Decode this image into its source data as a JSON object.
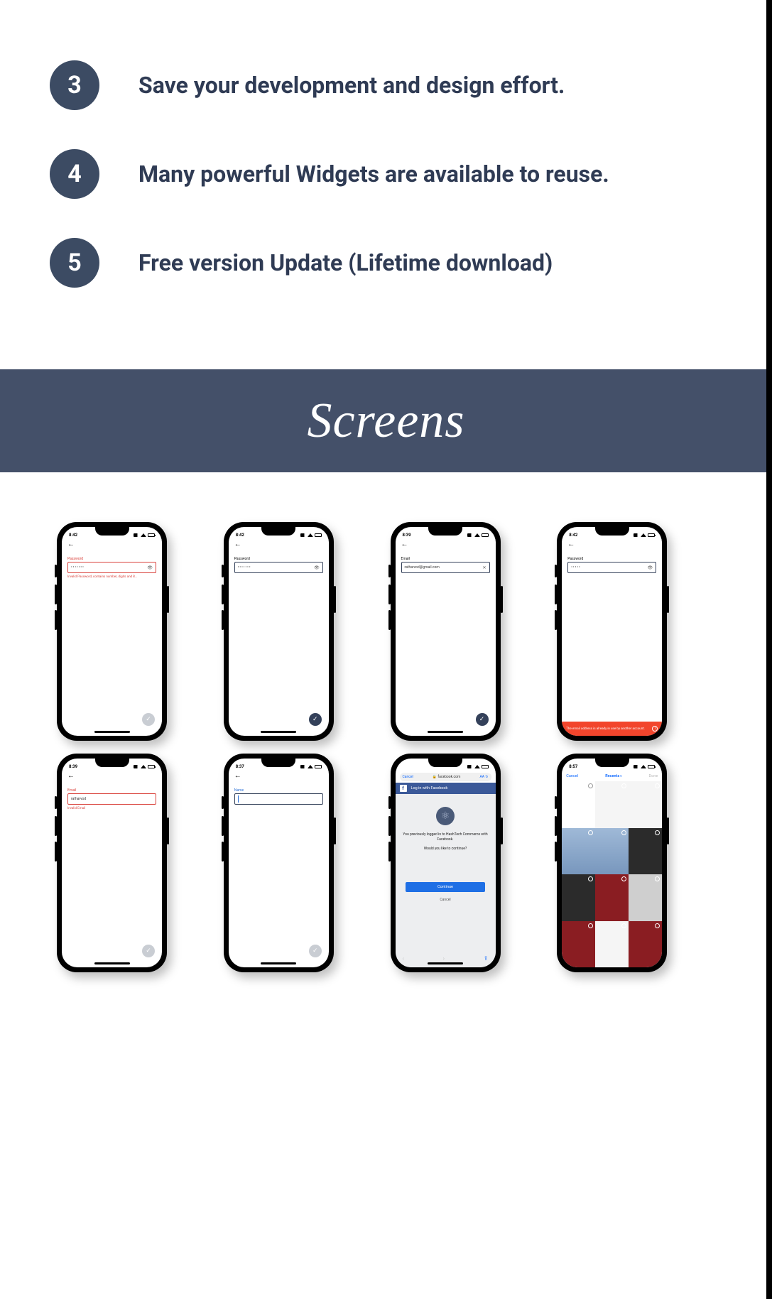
{
  "features": [
    {
      "num": "3",
      "text": "Save your development and design effort."
    },
    {
      "num": "4",
      "text": "Many powerful Widgets are available to reuse."
    },
    {
      "num": "5",
      "text": "Free version Update (Lifetime download)"
    }
  ],
  "section_title": "Screens",
  "phones": {
    "p1": {
      "time": "8:42",
      "label": "Password",
      "value": "•••••••",
      "helper": "Invalid Password, contains number, digits and 8…"
    },
    "p2": {
      "time": "8:42",
      "label": "Password",
      "value": "•••••••"
    },
    "p3": {
      "time": "8:39",
      "label": "Email",
      "value": "ratharvod@gmail.com"
    },
    "p4": {
      "time": "8:42",
      "label": "Password",
      "value": "•••••",
      "toast": "The email address is already in use by another account."
    },
    "p5": {
      "time": "8:39",
      "label": "Email",
      "value": "ratharvod",
      "helper": "Invalid Email"
    },
    "p6": {
      "time": "8:37",
      "label": "Name",
      "value": ""
    },
    "p7": {
      "cancel": "Cancel",
      "lock": "🔒",
      "domain": "facebook.com",
      "aa": "AA",
      "reload": "↻",
      "header": "Log in with Facebook",
      "msg": "You previously logged in to HashTech Commerce with Facebook.",
      "sub": "Would you like to continue?",
      "continue": "Continue",
      "cancel2": "Cancel"
    },
    "p8": {
      "time": "8:57",
      "cancel": "Cancel",
      "title": "Recents",
      "done": "Done"
    }
  }
}
